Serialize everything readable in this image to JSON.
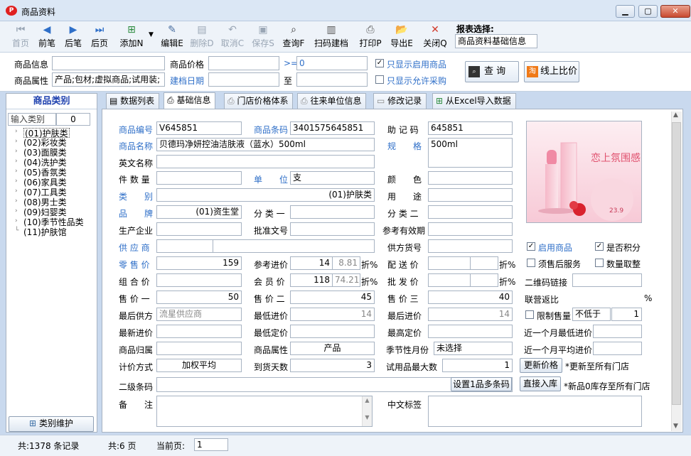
{
  "window": {
    "title": "商品资料",
    "minimize": "▁",
    "maximize": "▢",
    "close": "✕"
  },
  "toolbar": {
    "first": "首页",
    "prev": "前笔",
    "next": "后笔",
    "last": "后页",
    "add": "添加N",
    "edit": "编辑E",
    "delete": "删除D",
    "cancel": "取消C",
    "save": "保存S",
    "query": "查询F",
    "scan_create": "扫码建档",
    "print": "打印P",
    "export": "导出E",
    "close": "关闭Q",
    "report_label": "报表选择:",
    "report_value": "商品资料基础信息"
  },
  "filter": {
    "product_info_label": "商品信息",
    "price_label": "商品价格",
    "operator": ">=",
    "price_value": "0",
    "attr_label": "商品属性",
    "attr_value": "产品;包材;虚拟商品;试用装;",
    "date_label": "建档日期",
    "to_label": "至",
    "only_enabled": "只显示启用商品",
    "only_allowed": "只显示允许采购",
    "query_button": "查 询",
    "online_compare_button": "线上比价"
  },
  "left": {
    "title": "商品类别",
    "category_placeholder": "输入类别",
    "category_count": "0",
    "items": [
      "(01)护肤类",
      "(02)彩妆类",
      "(03)面膜类",
      "(04)洗护类",
      "(05)香氛类",
      "(06)家具类",
      "(07)工具类",
      "(08)男士类",
      "(09)妇婴类",
      "(10)季节性品类",
      "(11)护肤馆"
    ],
    "maintain_button": "类别维护"
  },
  "tabs": [
    "数据列表",
    "基础信息",
    "门店价格体系",
    "往来单位信息",
    "修改记录",
    "从Excel导入数据"
  ],
  "form": {
    "code_label": "商品编号",
    "code": "V645851",
    "barcode_label": "商品条码",
    "barcode": "3401575645851",
    "mnemonic_label": "助 记 码",
    "mnemonic": "645851",
    "name_label": "商品名称",
    "name": "贝德玛净妍控油洁肤液（蓝水）500ml",
    "spec_label": "规　　格",
    "spec": "500ml",
    "english_label": "英文名称",
    "count_label": "件 数 量",
    "unit_label": "单　　位",
    "unit": "支",
    "color_label": "颜　　色",
    "category_label": "类　　别",
    "category": "(01)护肤类",
    "usage_label": "用　　途",
    "brand_label": "品　　牌",
    "brand": "(01)资生堂",
    "class1_label": "分 类 一",
    "class2_label": "分 类 二",
    "maker_label": "生产企业",
    "approval_label": "批准文号",
    "validity_label": "参考有效期",
    "supplier_label": "供 应 商",
    "supplier_code_label": "供方货号",
    "retail_label": "零 售 价",
    "retail": "159",
    "ref_purchase_label": "参考进价",
    "ref_purchase": "14",
    "ref_discount": "8.81",
    "discount_unit": "折%",
    "delivery_label": "配 送 价",
    "combo_label": "组 合 价",
    "member_label": "会 员 价",
    "member": "118",
    "member_discount": "74.21",
    "wholesale_label": "批 发 价",
    "price1_label": "售 价 一",
    "price1": "50",
    "price2_label": "售 价 二",
    "price2": "45",
    "price3_label": "售 价 三",
    "price3": "40",
    "last_supplier_label": "最后供方",
    "last_supplier": "流星供应商",
    "min_purchase_label": "最低进价",
    "min_purchase": "14",
    "last_purchase_label": "最后进价",
    "last_purchase": "14",
    "latest_purchase_label": "最新进价",
    "min_price_label": "最低定价",
    "max_price_label": "最高定价",
    "belong_label": "商品归属",
    "attr_label": "商品属性",
    "attr": "产品",
    "season_label": "季节性月份",
    "season": "未选择",
    "pricing_label": "计价方式",
    "pricing": "加权平均",
    "arrival_label": "到货天数",
    "arrival": "3",
    "trial_label": "试用品最大数",
    "trial": "1",
    "secondary_label": "二级条码",
    "multi_barcode_button": "设置1品多条码",
    "direct_store_button": "直接入库",
    "direct_store_note": "*新品0库存至所有门店",
    "remark_label": "备　　注",
    "chinese_tag_label": "中文标签",
    "enabled": "启用商品",
    "points": "是否积分",
    "after_sale": "须售后服务",
    "qty_pick": "数量取整",
    "qr_label": "二维码链接",
    "rebate_label": "联营返比",
    "rebate_unit": "%",
    "limit_label": "限制售量",
    "not_less": "不低于",
    "limit_value": "1",
    "month_min_label": "近一个月最低进价",
    "month_avg_label": "近一个月平均进价",
    "update_price_button": "更新价格",
    "update_note": "*更新至所有门店",
    "image_text": "恋上氛围感",
    "image_price": "23.9"
  },
  "status": {
    "records": "共:1378 条记录",
    "pages": "共:6 页",
    "current_label": "当前页:",
    "current_page": "1"
  }
}
